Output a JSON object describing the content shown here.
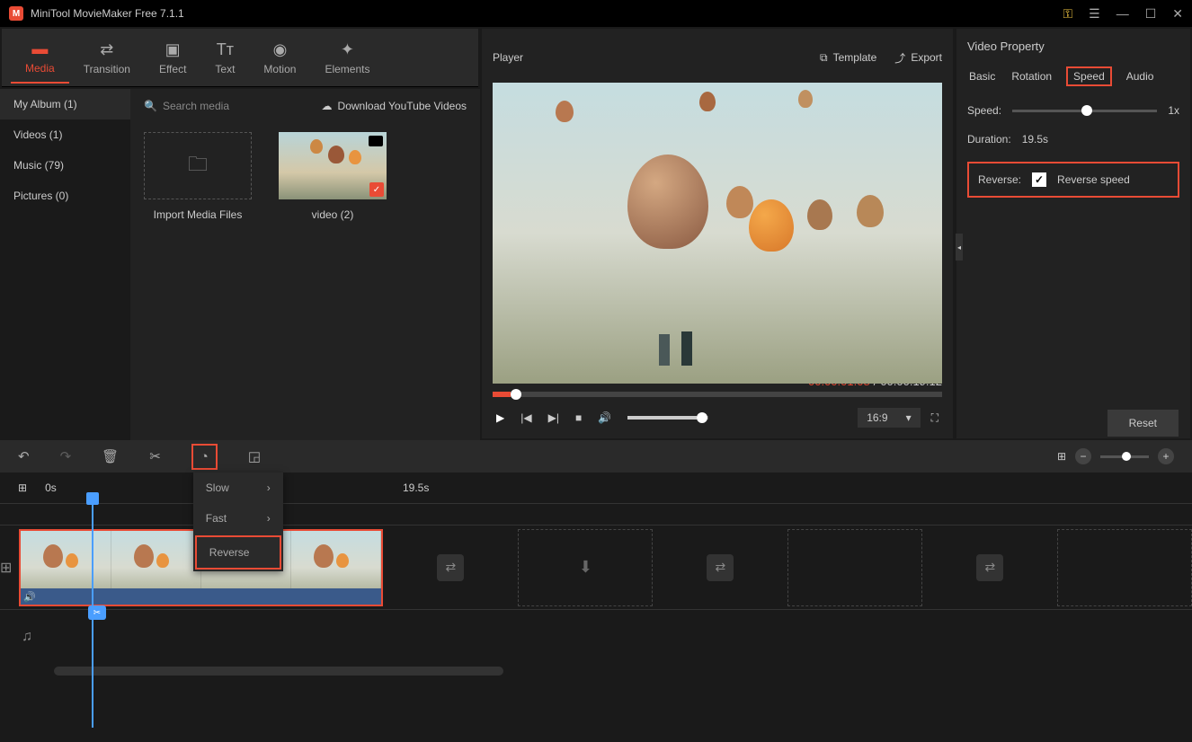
{
  "app": {
    "title": "MiniTool MovieMaker Free 7.1.1"
  },
  "toolbar": {
    "media": "Media",
    "transition": "Transition",
    "effect": "Effect",
    "text": "Text",
    "motion": "Motion",
    "elements": "Elements"
  },
  "sidebar": {
    "myalbum": "My Album (1)",
    "videos": "Videos (1)",
    "music": "Music (79)",
    "pictures": "Pictures (0)"
  },
  "media": {
    "search_placeholder": "Search media",
    "download": "Download YouTube Videos",
    "import": "Import Media Files",
    "video_name": "video (2)"
  },
  "player": {
    "title": "Player",
    "template": "Template",
    "export": "Export",
    "current_time": "00:00:01.08",
    "sep": "/",
    "total_time": "00:00:19.12",
    "aspect": "16:9"
  },
  "property": {
    "title": "Video Property",
    "tabs": {
      "basic": "Basic",
      "rotation": "Rotation",
      "speed": "Speed",
      "audio": "Audio"
    },
    "speed_label": "Speed:",
    "speed_value": "1x",
    "duration_label": "Duration:",
    "duration_value": "19.5s",
    "reverse_label": "Reverse:",
    "reverse_text": "Reverse speed",
    "reset": "Reset"
  },
  "speed_menu": {
    "slow": "Slow",
    "fast": "Fast",
    "reverse": "Reverse"
  },
  "timeline": {
    "t0": "0s",
    "t1": "19.5s"
  }
}
